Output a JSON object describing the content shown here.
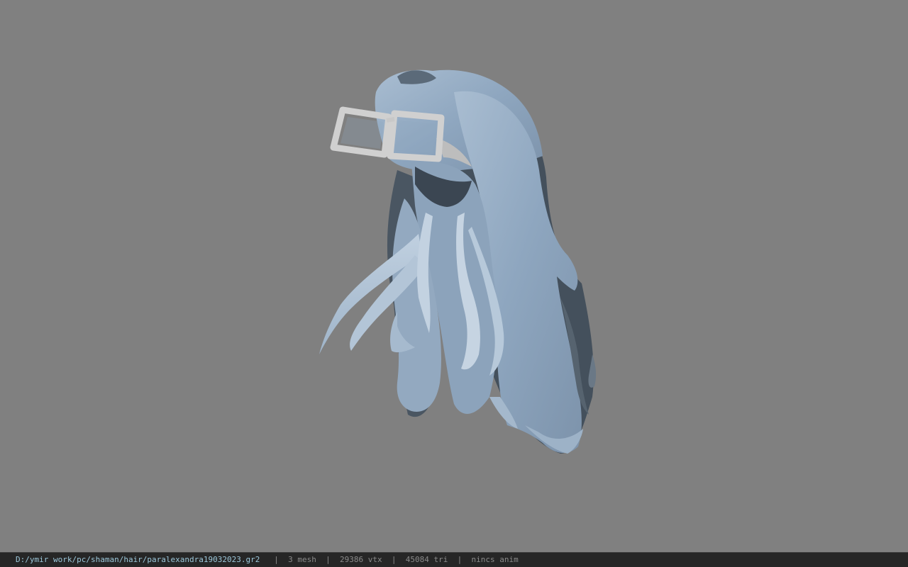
{
  "viewer": {
    "background_color": "#808080",
    "model_description": "hair mesh",
    "model_colors": {
      "hair": "#8ea6bf",
      "hair_highlight": "#b8cadb",
      "hair_shadow": "#3f4a55",
      "glasses": "#c4c4c4"
    }
  },
  "status": {
    "path": "D:/ymir work/pc/shaman/hair/paralexandra19032023.gr2",
    "mesh": "3 mesh",
    "vtx": "29386 vtx",
    "tri": "45084 tri",
    "anim": "nincs anim",
    "separator": "|"
  }
}
